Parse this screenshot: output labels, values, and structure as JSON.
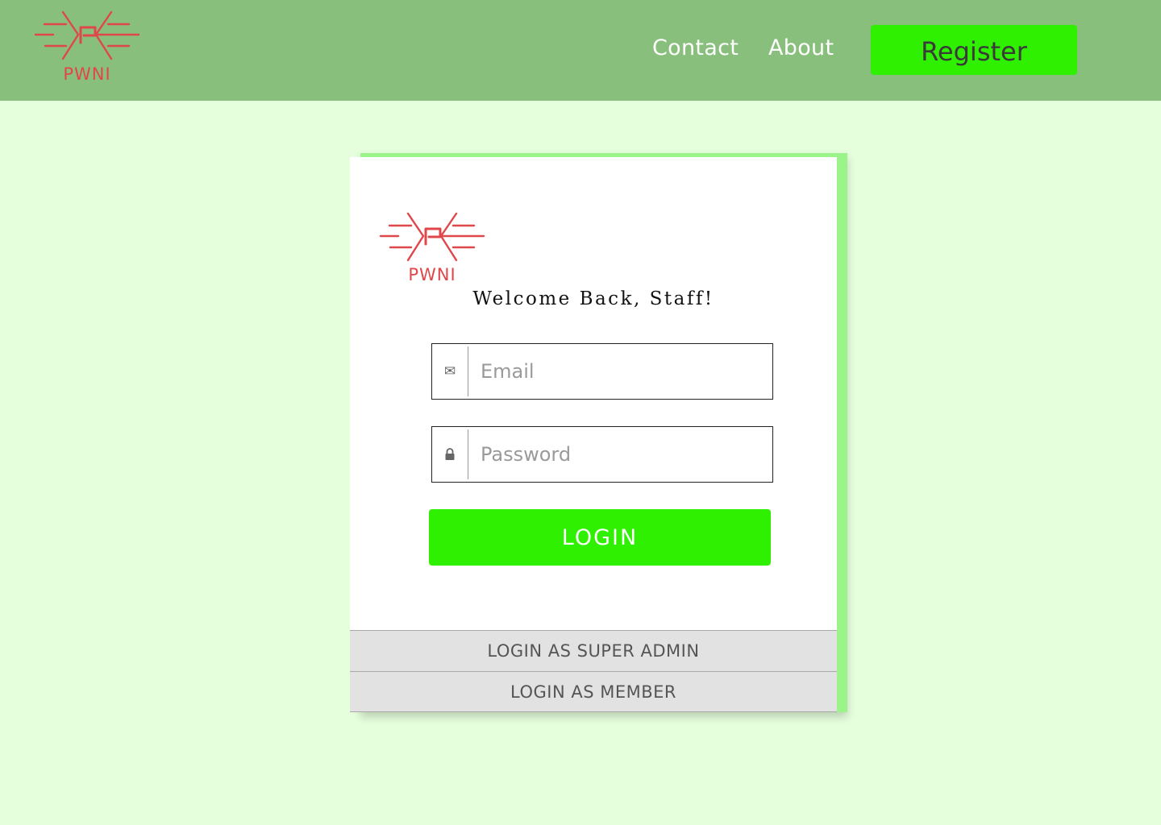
{
  "header": {
    "logo_text": "PWNI",
    "nav": [
      {
        "label": "Contact"
      },
      {
        "label": "About"
      }
    ],
    "register_label": "Register"
  },
  "login_card": {
    "logo_text": "PWNI",
    "welcome": "Welcome Back, Staff!",
    "email": {
      "placeholder": "Email",
      "icon": "envelope-icon"
    },
    "password": {
      "placeholder": "Password",
      "icon": "lock-icon"
    },
    "login_label": "LOGIN",
    "alt_super_admin_label": "LOGIN AS SUPER ADMIN",
    "alt_member_label": "LOGIN AS MEMBER"
  },
  "colors": {
    "header_bg": "#89bf7c",
    "page_bg": "#e5fedc",
    "accent_green": "#2ff000",
    "card_accent": "#9af48a",
    "logo_red": "#e0474a"
  }
}
